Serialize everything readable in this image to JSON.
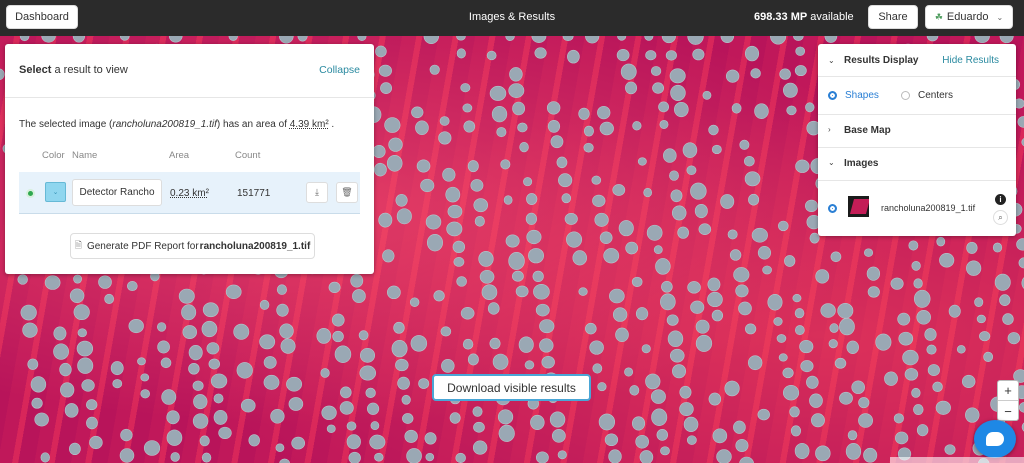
{
  "topbar": {
    "dashboard_label": "Dashboard",
    "title": "Images & Results",
    "mp_value": "698.33 MP",
    "mp_suffix": " available",
    "share_label": "Share",
    "user_label": "Eduardo"
  },
  "result_panel": {
    "header_bold": "Select",
    "header_rest": " a result to view",
    "collapse_label": "Collapse",
    "sel_prefix": "The selected image (",
    "sel_filename": "rancholuna200819_1.tif",
    "sel_mid": ") has an area of ",
    "sel_area": "4.39 km²",
    "sel_suffix": " .",
    "columns": [
      "Color",
      "Name",
      "Area",
      "Count"
    ],
    "row": {
      "name": "Detector Rancho",
      "area": "0.23 km²",
      "count": "151771"
    },
    "pdf_prefix": "Generate PDF Report for ",
    "pdf_filename": "rancholuna200819_1.tif"
  },
  "display_panel": {
    "results_display_label": "Results Display",
    "hide_results_label": "Hide Results",
    "shapes_label": "Shapes",
    "centers_label": "Centers",
    "base_map_label": "Base Map",
    "images_label": "Images",
    "image_name": "rancholuna200819_1.tif",
    "info_glyph": "i"
  },
  "map": {
    "download_label": "Download visible results",
    "zoom_in": "+",
    "zoom_out": "−"
  },
  "colors": {
    "accent": "#2a8aa0",
    "map_bg": "#c41d57",
    "blob": "#9aa8b4",
    "topbar": "#2b2b2b"
  }
}
